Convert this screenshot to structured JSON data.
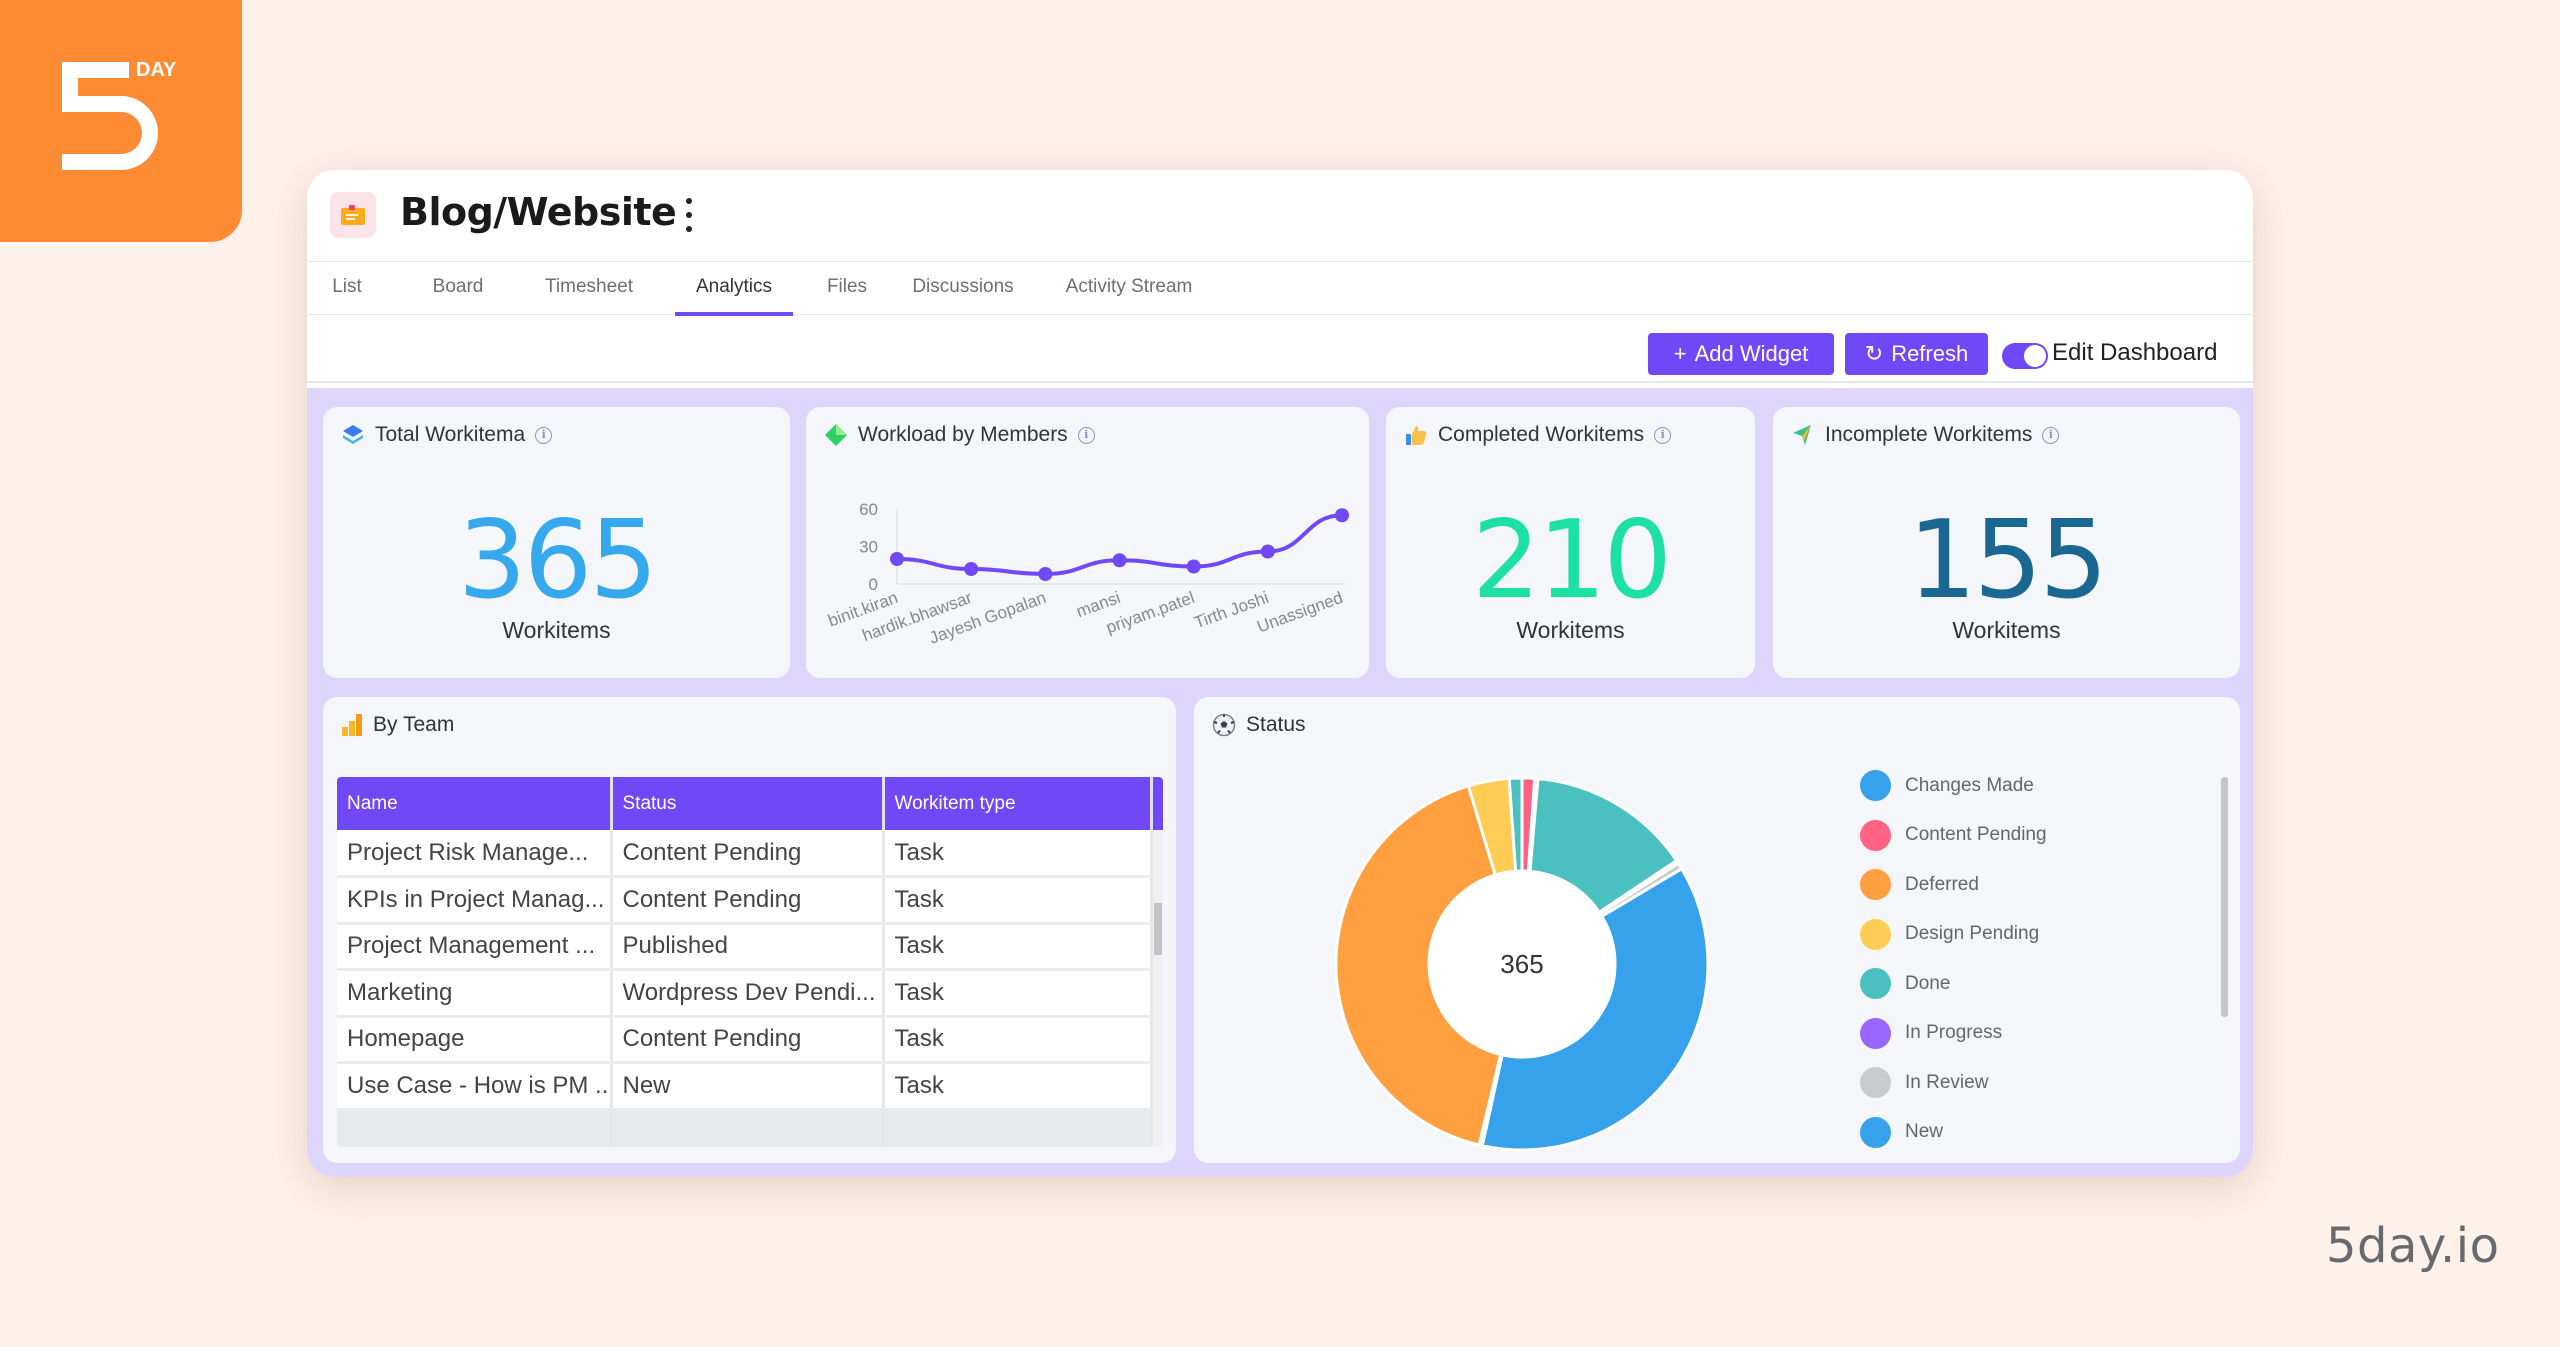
{
  "brand": {
    "logo_text": "DAY",
    "footer": "5day.io",
    "color": "#fd8b33"
  },
  "header": {
    "project_icon": "folder-icon",
    "title": "Blog/Website"
  },
  "tabs": [
    {
      "label": "List",
      "active": false
    },
    {
      "label": "Board",
      "active": false
    },
    {
      "label": "Timesheet",
      "active": false
    },
    {
      "label": "Analytics",
      "active": true
    },
    {
      "label": "Files",
      "active": false
    },
    {
      "label": "Discussions",
      "active": false
    },
    {
      "label": "Activity Stream",
      "active": false
    }
  ],
  "toolbar": {
    "add_widget": "Add Widget",
    "refresh": "Refresh",
    "edit_dashboard": "Edit Dashboard",
    "edit_dashboard_on": true,
    "accent": "#7048f5"
  },
  "widgets": {
    "total": {
      "title": "Total Workitema",
      "value": "365",
      "unit": "Workitems",
      "color": "#35a8ee"
    },
    "workload": {
      "title": "Workload by Members"
    },
    "completed": {
      "title": "Completed Workitems",
      "value": "210",
      "unit": "Workitems",
      "color": "#1de0a4"
    },
    "incomplete": {
      "title": "Incomplete Workitems",
      "value": "155",
      "unit": "Workitems",
      "color": "#1a6791"
    },
    "by_team": {
      "title": "By Team",
      "columns": [
        "Name",
        "Status",
        "Workitem type"
      ],
      "rows": [
        [
          "Project Risk Manage...",
          "Content Pending",
          "Task"
        ],
        [
          "KPIs in Project Manag...",
          "Content Pending",
          "Task"
        ],
        [
          "Project Management ...",
          "Published",
          "Task"
        ],
        [
          "Marketing",
          "Wordpress Dev Pendi...",
          "Task"
        ],
        [
          "Homepage",
          "Content Pending",
          "Task"
        ],
        [
          "Use Case - How is PM ...",
          "New",
          "Task"
        ]
      ]
    },
    "status": {
      "title": "Status",
      "center_label": "365"
    }
  },
  "chart_data": [
    {
      "type": "line",
      "title": "Workload by Members",
      "categories": [
        "binit.kiran",
        "hardik.bhawsar",
        "Jayesh Gopalan",
        "mansi",
        "priyam.patel",
        "Tirth Joshi",
        "Unassigned"
      ],
      "values": [
        20,
        12,
        8,
        19,
        14,
        26,
        55
      ],
      "yticks": [
        0,
        30,
        60
      ],
      "ylim": [
        0,
        60
      ],
      "color": "#7048f5",
      "grid": false
    },
    {
      "type": "pie",
      "variant": "doughnut",
      "title": "Status",
      "center_label": "365",
      "legend_position": "right",
      "slices": [
        {
          "label": "Changes Made",
          "value": 0,
          "color": "#36a2eb"
        },
        {
          "label": "Content Pending",
          "value": 4,
          "color": "#ff6384"
        },
        {
          "label": "Deferred",
          "value": 1,
          "color": "#ff9f40"
        },
        {
          "label": "Design Pending",
          "value": 0,
          "color": "#ffcd56"
        },
        {
          "label": "Done",
          "value": 52,
          "color": "#4bc0c0"
        },
        {
          "label": "In Progress",
          "value": 1,
          "color": "#9966ff"
        },
        {
          "label": "In Review",
          "value": 2,
          "color": "#c9cbcf"
        },
        {
          "label": "New",
          "value": 135,
          "color": "#36a2eb"
        },
        {
          "label": "",
          "value": 1,
          "color": "#ff6384"
        },
        {
          "label": "",
          "value": 152,
          "color": "#ff9f40"
        },
        {
          "label": "",
          "value": 13,
          "color": "#ffcd56"
        },
        {
          "label": "",
          "value": 4,
          "color": "#4bc0c0"
        }
      ],
      "legend_visible": [
        "Changes Made",
        "Content Pending",
        "Deferred",
        "Design Pending",
        "Done",
        "In Progress",
        "In Review",
        "New"
      ]
    }
  ]
}
